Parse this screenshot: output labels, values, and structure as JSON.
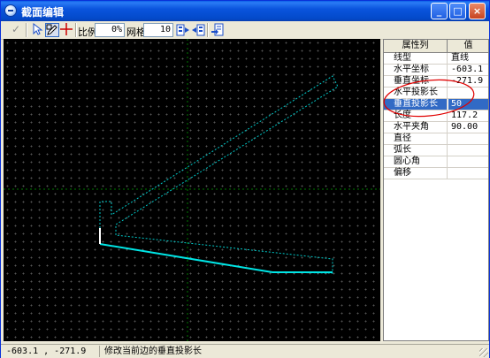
{
  "window": {
    "title": "截面编辑",
    "buttons": {
      "minimize": "_",
      "maximize": "□",
      "close": "×"
    }
  },
  "toolbar": {
    "confirm_icon": "checkmark-icon",
    "select_icon": "arrow-pointer-icon",
    "edit_vertex_icon": "pen-edit-icon",
    "origin_icon": "crosshair-icon",
    "scale_label": "比例",
    "scale_value": "0%",
    "grid_label": "网格",
    "grid_value": "10",
    "tool1_icon": "section-copy-icon",
    "tool2_icon": "section-mirror-icon",
    "export_icon": "export-icon"
  },
  "properties": {
    "header_name": "属性列",
    "header_value": "值",
    "rows": [
      {
        "name": "线型",
        "value": "直线"
      },
      {
        "name": "水平坐标",
        "value": "-603.1"
      },
      {
        "name": "垂直坐标",
        "value": "-271.9"
      },
      {
        "name": "水平投影长",
        "value": ""
      },
      {
        "name": "垂直投影长",
        "value": "50"
      },
      {
        "name": "长度",
        "value": "117.2"
      },
      {
        "name": "水平夹角",
        "value": "90.00"
      },
      {
        "name": "直径",
        "value": ""
      },
      {
        "name": "弧长",
        "value": ""
      },
      {
        "name": "圆心角",
        "value": ""
      },
      {
        "name": "偏移",
        "value": ""
      }
    ],
    "selected_row": 4
  },
  "status": {
    "coords": "-603.1 ,  -271.9",
    "message": "修改当前边的垂直投影长"
  },
  "colors": {
    "canvas_bg": "#000000",
    "section_outline": "#00c8c8",
    "selected_edge": "#ffffff",
    "active_edge": "#00e5e5",
    "axis": "#007a00",
    "annotation": "#e00000"
  }
}
